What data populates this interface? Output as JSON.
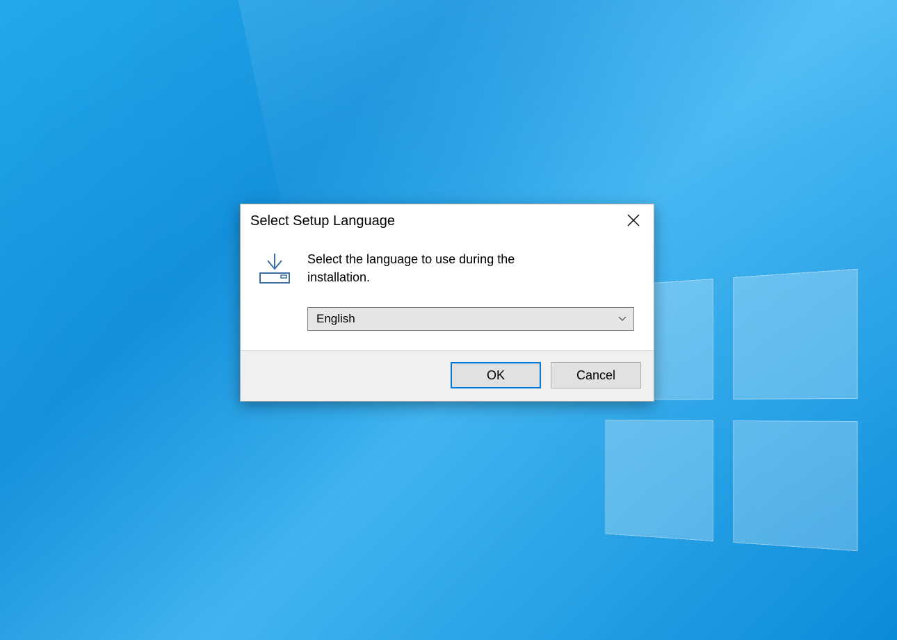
{
  "dialog": {
    "title": "Select Setup Language",
    "instruction": "Select the language to use during the installation.",
    "selected_language": "English",
    "ok_label": "OK",
    "cancel_label": "Cancel"
  }
}
